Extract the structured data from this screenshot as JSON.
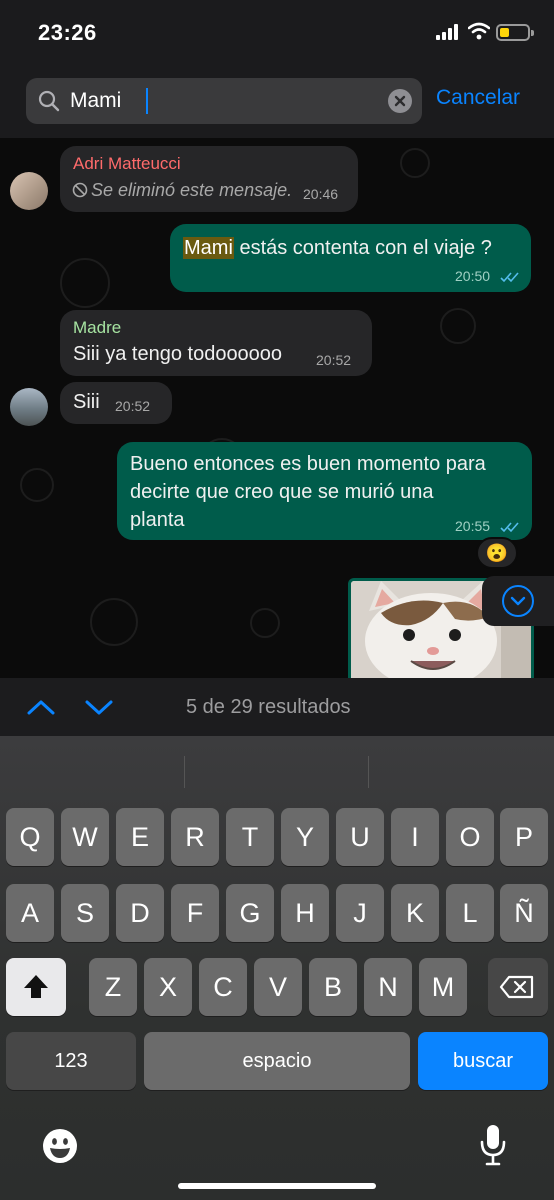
{
  "status_bar": {
    "time": "23:26"
  },
  "search": {
    "query": "Mami",
    "cancel_label": "Cancelar"
  },
  "messages": [
    {
      "sender": "Adri Matteucci",
      "sender_color": "#ff6b6b",
      "text": "Se eliminó este mensaje.",
      "time": "20:46",
      "direction": "in",
      "deleted": true
    },
    {
      "text_highlight": "Mami",
      "text_rest": " estás contenta con el viaje ?",
      "time": "20:50",
      "direction": "out"
    },
    {
      "sender": "Madre",
      "sender_color": "#a6e3a1",
      "text": "Siii ya tengo todoooooo",
      "time": "20:52",
      "direction": "in"
    },
    {
      "text": "Siii",
      "time": "20:52",
      "direction": "in"
    },
    {
      "text_lines": [
        "Bueno entonces es buen momento para",
        "decirte que creo que se murió una",
        "planta"
      ],
      "time": "20:55",
      "direction": "out",
      "reaction": "😮"
    }
  ],
  "results": {
    "label": "5 de 29 resultados"
  },
  "keyboard": {
    "row1": [
      "Q",
      "W",
      "E",
      "R",
      "T",
      "Y",
      "U",
      "I",
      "O",
      "P"
    ],
    "row2": [
      "A",
      "S",
      "D",
      "F",
      "G",
      "H",
      "J",
      "K",
      "L",
      "Ñ"
    ],
    "row3": [
      "Z",
      "X",
      "C",
      "V",
      "B",
      "N",
      "M"
    ],
    "numbers_label": "123",
    "space_label": "espacio",
    "search_label": "buscar"
  },
  "icons": [
    "signal-icon",
    "wifi-icon",
    "battery-icon",
    "search-icon",
    "clear-icon",
    "deleted-icon",
    "read-ticks-icon",
    "chevron-down-icon",
    "arrow-up-icon",
    "arrow-down-icon",
    "shift-icon",
    "backspace-icon",
    "emoji-icon",
    "microphone-icon"
  ],
  "colors": {
    "accent": "#0a84ff",
    "outgoing_bubble": "#005c4b",
    "incoming_bubble": "#262628"
  }
}
